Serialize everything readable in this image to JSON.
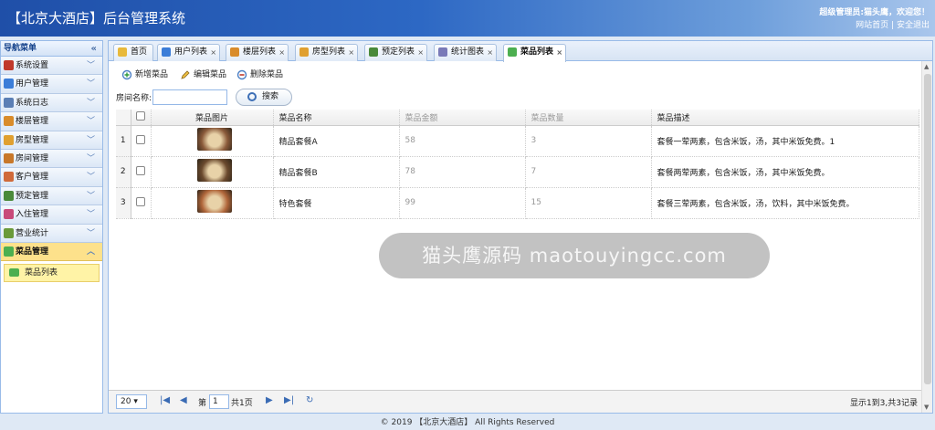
{
  "header": {
    "title": "【北京大酒店】后台管理系统",
    "admin_greeting": "超级管理员:猫头鹰，欢迎您！",
    "site_home": "网站首页",
    "separator": "|",
    "logout": "安全退出"
  },
  "sidebar": {
    "title": "导航菜单",
    "collapse_glyph": "«",
    "items": [
      {
        "label": "系统设置",
        "color": "#c0392b"
      },
      {
        "label": "用户管理",
        "color": "#3b7dd8"
      },
      {
        "label": "系统日志",
        "color": "#5b7fb5"
      },
      {
        "label": "楼层管理",
        "color": "#d98c2b"
      },
      {
        "label": "房型管理",
        "color": "#e0a030"
      },
      {
        "label": "房间管理",
        "color": "#c8782a"
      },
      {
        "label": "客户管理",
        "color": "#d06a3a"
      },
      {
        "label": "预定管理",
        "color": "#4a8a3a"
      },
      {
        "label": "入住管理",
        "color": "#c84a7a"
      },
      {
        "label": "营业统计",
        "color": "#6a9a3a"
      },
      {
        "label": "菜品管理",
        "color": "#4caf50"
      }
    ],
    "sub_item": "菜品列表"
  },
  "tabs": [
    {
      "label": "首页",
      "color": "#e8b93a"
    },
    {
      "label": "用户列表",
      "color": "#3b7dd8"
    },
    {
      "label": "楼层列表",
      "color": "#d98c2b"
    },
    {
      "label": "房型列表",
      "color": "#e0a030"
    },
    {
      "label": "预定列表",
      "color": "#4a8a3a"
    },
    {
      "label": "统计图表",
      "color": "#7a7ab8"
    },
    {
      "label": "菜品列表",
      "color": "#4caf50"
    }
  ],
  "tab_close": "×",
  "toolbar": {
    "add": "新增菜品",
    "edit": "编辑菜品",
    "delete": "删除菜品"
  },
  "search": {
    "label": "房间名称:",
    "value": "",
    "button": "搜索"
  },
  "grid": {
    "columns": [
      "菜品图片",
      "菜品名称",
      "菜品金额",
      "菜品数量",
      "菜品描述"
    ],
    "rows": [
      {
        "num": "1",
        "name": "精品套餐A",
        "price": "58",
        "qty": "3",
        "desc": "套餐一荤两素，包含米饭，汤，其中米饭免费。1",
        "img": "#8a5a3a"
      },
      {
        "num": "2",
        "name": "精品套餐B",
        "price": "78",
        "qty": "7",
        "desc": "套餐两荤两素，包含米饭，汤，其中米饭免费。",
        "img": "#6b4a2e"
      },
      {
        "num": "3",
        "name": "特色套餐",
        "price": "99",
        "qty": "15",
        "desc": "套餐三荤两素，包含米饭，汤，饮料，其中米饭免费。",
        "img": "#b0663a"
      }
    ]
  },
  "pager": {
    "page_size": "20",
    "page_prefix": "第",
    "page_value": "1",
    "page_suffix": "共1页",
    "summary": "显示1到3,共3记录"
  },
  "watermark": "猫头鹰源码 maotouyingcc.com",
  "footer": "© 2019 【北京大酒店】 All Rights Reserved"
}
